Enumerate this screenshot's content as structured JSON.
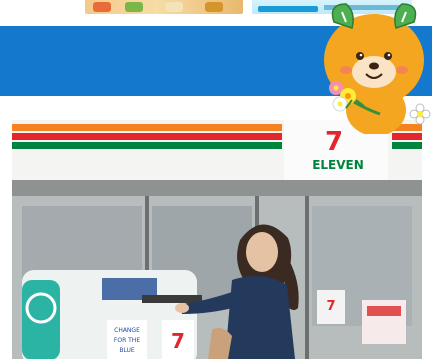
{
  "banner": {
    "left_image": "promo-thumbnail",
    "right_image": "promo-thumbnail"
  },
  "photo": {
    "store_sign_text": "ELEVEN",
    "store_sign_number": "7",
    "machine_label_1": "CHANGE",
    "machine_label_2": "FOR THE",
    "machine_label_3": "BLUE",
    "colors": {
      "seven_eleven_red": "#e4262c",
      "seven_eleven_green": "#00843d",
      "seven_eleven_orange": "#f58220"
    }
  },
  "mascot": {
    "name_icon": "mikyan-mascot-icon"
  },
  "colors": {
    "band_blue": "#1479cc"
  }
}
